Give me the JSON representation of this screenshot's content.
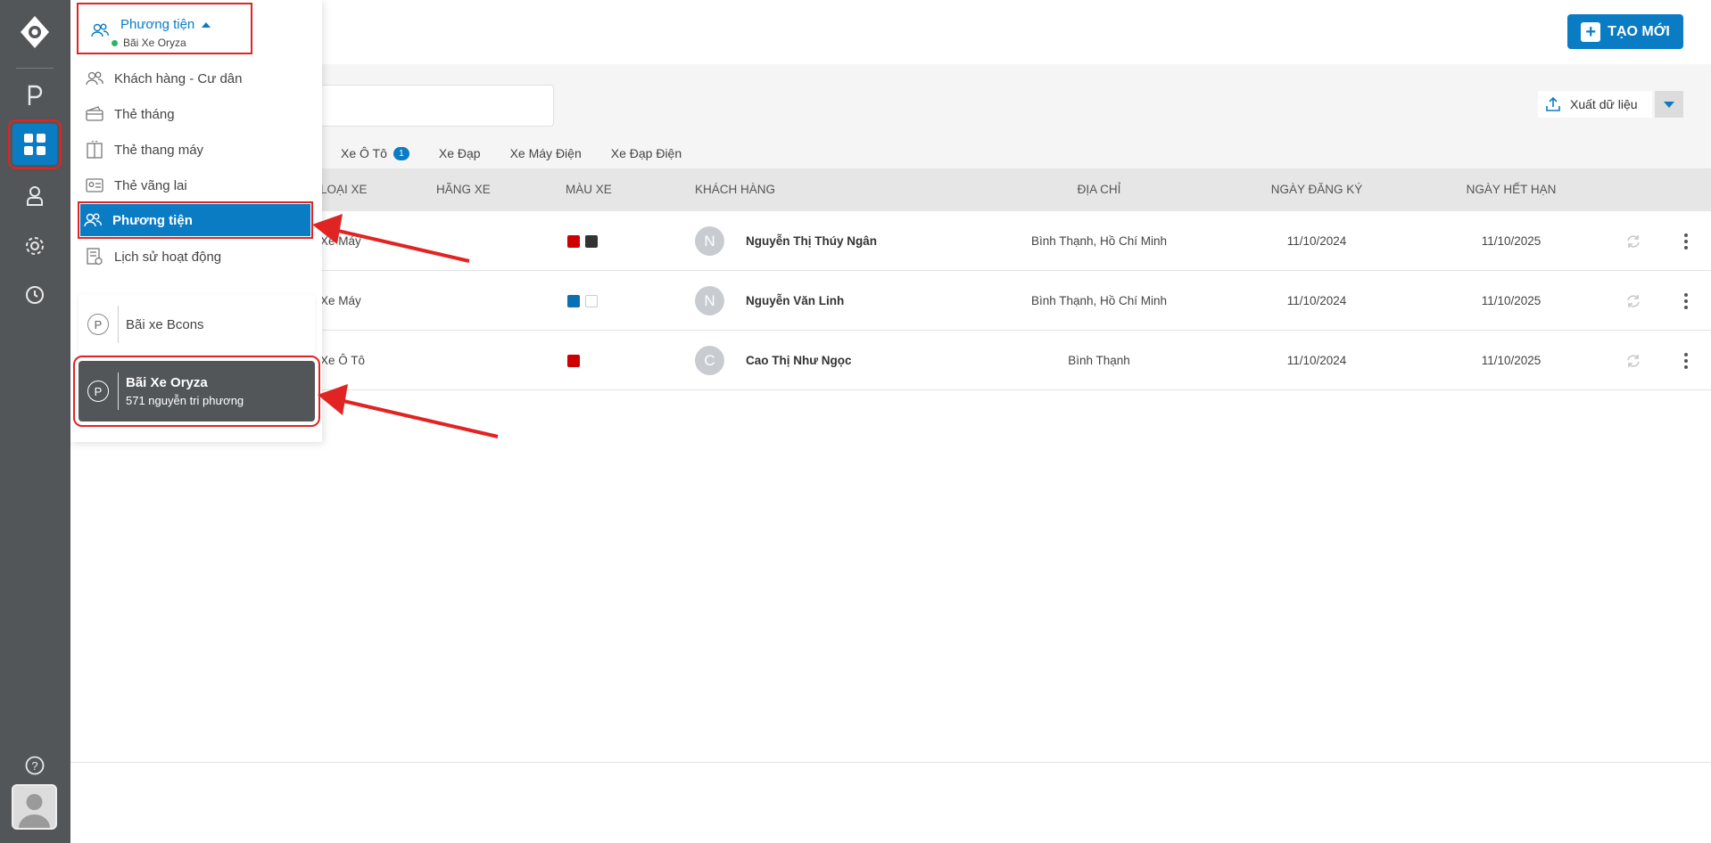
{
  "rail": {
    "items": [
      {
        "name": "parking-icon"
      },
      {
        "name": "dashboard-grid-icon",
        "active": true
      },
      {
        "name": "user-icon"
      },
      {
        "name": "settings-gear-icon"
      },
      {
        "name": "history-clock-icon"
      }
    ],
    "help_icon": "question-icon"
  },
  "header": {
    "create_label": "TẠO MỚI"
  },
  "toolbar": {
    "export_label": "Xuất dữ liệu"
  },
  "tabs": [
    {
      "label": "Xe Ô Tô",
      "badge": "1"
    },
    {
      "label": "Xe Đạp"
    },
    {
      "label": "Xe Máy Điện"
    },
    {
      "label": "Xe Đạp Điện"
    }
  ],
  "table": {
    "columns": [
      "LOẠI XE",
      "HÃNG XE",
      "MÀU XE",
      "KHÁCH HÀNG",
      "ĐỊA CHỈ",
      "NGÀY ĐĂNG KÝ",
      "NGÀY HẾT HẠN"
    ],
    "rows": [
      {
        "type": "Xe Máy",
        "colors": [
          "#cc0000",
          "#333333"
        ],
        "initial": "N",
        "customer": "Nguyễn Thị Thúy Ngân",
        "address": "Bình Thạnh, Hồ Chí Minh",
        "registered": "11/10/2024",
        "expires": "11/10/2025"
      },
      {
        "type": "Xe Máy",
        "colors": [
          "#0a70b5",
          "#ffffff"
        ],
        "initial": "N",
        "customer": "Nguyễn Văn Linh",
        "address": "Bình Thạnh, Hồ Chí Minh",
        "registered": "11/10/2024",
        "expires": "11/10/2025"
      },
      {
        "type": "Xe Ô Tô",
        "colors": [
          "#cc0000"
        ],
        "initial": "C",
        "customer": "Cao Thị Như Ngọc",
        "address": "Bình Thạnh",
        "registered": "11/10/2024",
        "expires": "11/10/2025"
      }
    ]
  },
  "menu": {
    "title": "Phương tiện",
    "subtitle": "Bãi Xe Oryza",
    "items": [
      {
        "label": "Khách hàng - Cư dân",
        "icon": "users-icon"
      },
      {
        "label": "Thẻ tháng",
        "icon": "card-icon"
      },
      {
        "label": "Thẻ thang máy",
        "icon": "elevator-icon"
      },
      {
        "label": "Thẻ vãng lai",
        "icon": "id-card-icon"
      },
      {
        "label": "Phương tiện",
        "icon": "users-icon",
        "active": true
      },
      {
        "label": "Lịch sử hoạt động",
        "icon": "history-list-icon"
      }
    ],
    "lots": [
      {
        "name": "Bãi xe Bcons",
        "address": ""
      },
      {
        "name": "Bãi Xe Oryza",
        "address": "571 nguyễn tri phương",
        "active": true
      }
    ]
  },
  "colors": {
    "primary": "#0a7cc4",
    "rail": "#535659",
    "annotation": "#e02424"
  }
}
